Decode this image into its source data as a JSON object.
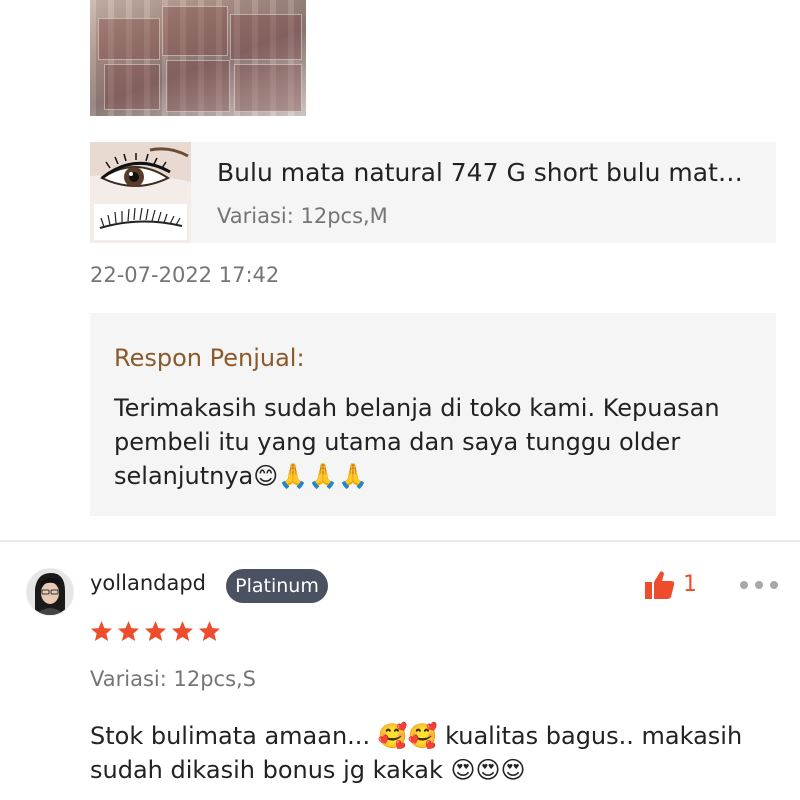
{
  "product": {
    "name": "Bulu mata natural 747 G short bulu mat…",
    "variant": "Variasi: 12pcs,M"
  },
  "review_top": {
    "date": "22-07-2022 17:42",
    "seller_response_title": "Respon Penjual:",
    "seller_response_text": "Terimakasih sudah belanja di toko kami. Kepuasan pembeli itu yang utama dan saya tunggu older selanjutnya😊🙏🙏🙏"
  },
  "review_bottom": {
    "username": "yollandapd",
    "badge": "Platinum",
    "like_count": "1",
    "rating": 5,
    "variant": "Variasi: 12pcs,S",
    "text": "Stok bulimata amaan... 🥰🥰 kualitas bagus.. makasih sudah dikasih bonus jg kakak 😍😍😍"
  },
  "colors": {
    "accent": "#ee4d2d",
    "star": "#ee4d2d",
    "seller_title": "#8a5a2b",
    "badge_bg": "#4a5161",
    "card_bg": "#f5f5f5"
  },
  "icons": {
    "like": "thumbs-up-icon",
    "more": "more-dots-icon",
    "star": "star-icon"
  }
}
